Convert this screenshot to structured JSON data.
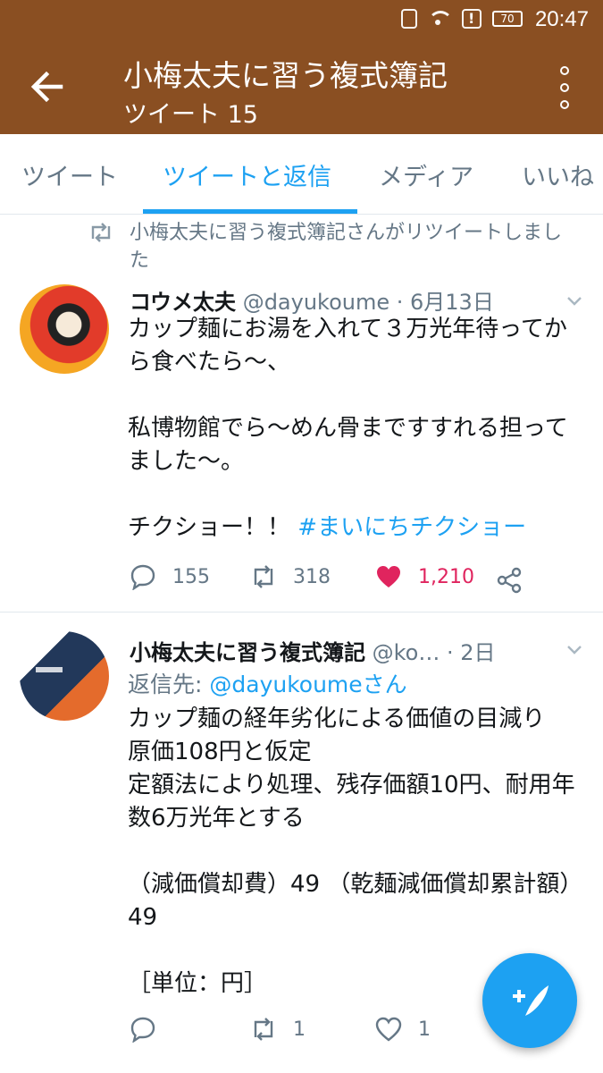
{
  "status_bar": {
    "time": "20:47",
    "battery": "70"
  },
  "header": {
    "title": "小梅太夫に習う複式簿記",
    "subtitle": "ツイート 15"
  },
  "tabs": [
    {
      "label": "ツイート"
    },
    {
      "label": "ツイートと返信",
      "active": true
    },
    {
      "label": "メディア"
    },
    {
      "label": "いいね"
    }
  ],
  "tweets": [
    {
      "retweet_note": "小梅太夫に習う複式簿記さんがリツイートしました",
      "name": "コウメ太夫",
      "handle": "@dayukoume · 6月13日",
      "body": "カップ麺にお湯を入れて３万光年待ってから食べたら〜、\n\n私博物館でら〜めん骨まですすれる担ってました〜。\n\nチクショー！！",
      "hashtag": "#まいにちチクショー",
      "replies": "155",
      "retweets": "318",
      "likes": "1,210"
    },
    {
      "name": "小梅太夫に習う複式簿記",
      "handle": "@ko… · 2日",
      "reply_prefix": "返信先: ",
      "reply_to": "@dayukoumeさん",
      "body": "カップ麺の経年劣化による価値の目減り\n原価108円と仮定\n定額法により処理、残存価額10円、耐用年数6万光年とする\n\n（減価償却費）49 （乾麺減価償却累計額）49\n\n［単位：円］",
      "replies": "",
      "retweets": "1",
      "likes": "1"
    }
  ],
  "colors": {
    "brand": "#8a4f22",
    "accent": "#1da1f2",
    "like": "#e0245e",
    "muted": "#657786"
  },
  "icons": [
    "back-arrow-icon",
    "more-vert-icon",
    "retweet-icon",
    "chevron-down-icon",
    "reply-icon",
    "heart-icon",
    "share-icon",
    "compose-icon"
  ]
}
